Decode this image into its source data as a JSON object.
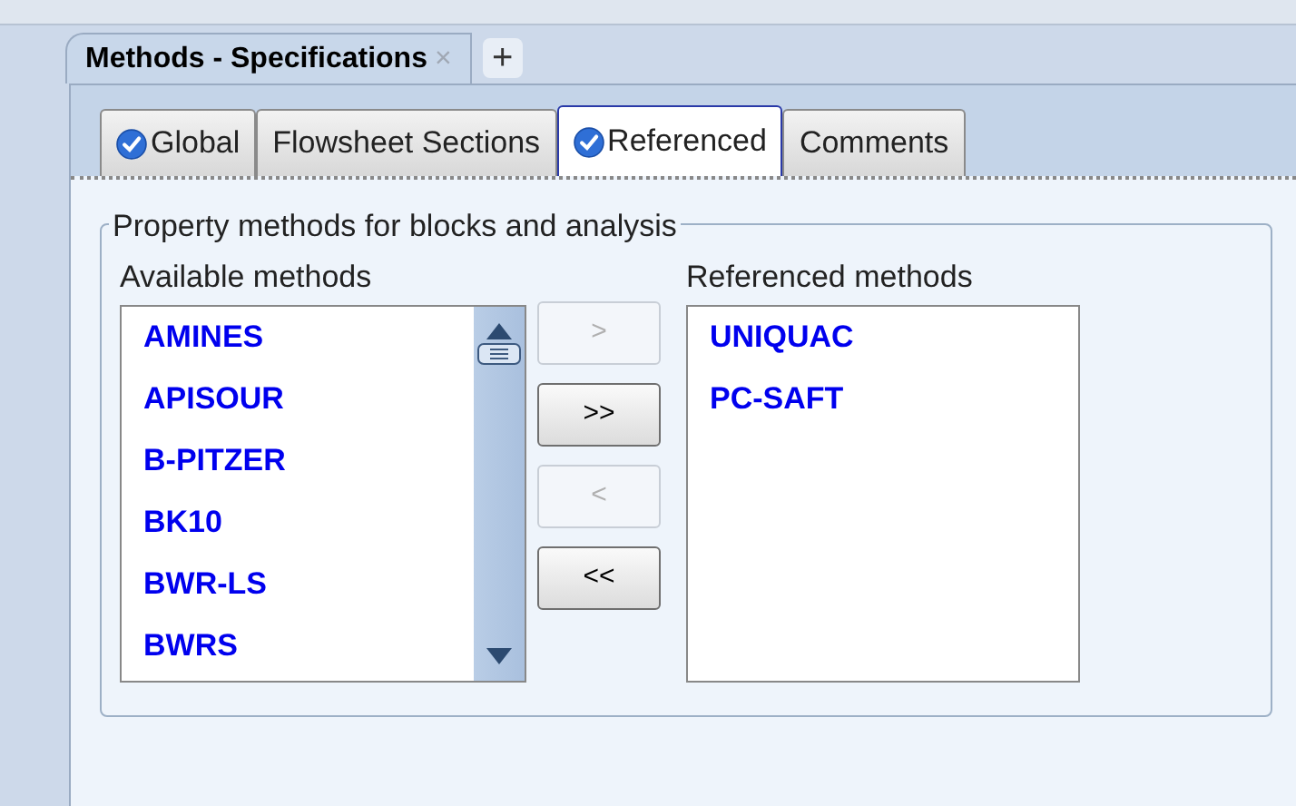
{
  "document_tabs": [
    {
      "label": "Methods - Specifications",
      "selected": true,
      "close": "×"
    }
  ],
  "new_tab": "+",
  "tabs": [
    {
      "label": "Global",
      "checked": true,
      "selected": false
    },
    {
      "label": "Flowsheet Sections",
      "checked": false,
      "selected": false
    },
    {
      "label": "Referenced",
      "checked": true,
      "selected": true
    },
    {
      "label": "Comments",
      "checked": false,
      "selected": false
    }
  ],
  "group": {
    "title": "Property methods for blocks and analysis",
    "available": {
      "label": "Available methods",
      "items": [
        "AMINES",
        "APISOUR",
        "B-PITZER",
        "BK10",
        "BWR-LS",
        "BWRS"
      ]
    },
    "buttons": [
      {
        "label": ">",
        "disabled": true
      },
      {
        "label": ">>",
        "disabled": false
      },
      {
        "label": "<",
        "disabled": true
      },
      {
        "label": "<<",
        "disabled": false
      }
    ],
    "referenced": {
      "label": "Referenced methods",
      "items": [
        "UNIQUAC",
        "PC-SAFT"
      ]
    }
  }
}
